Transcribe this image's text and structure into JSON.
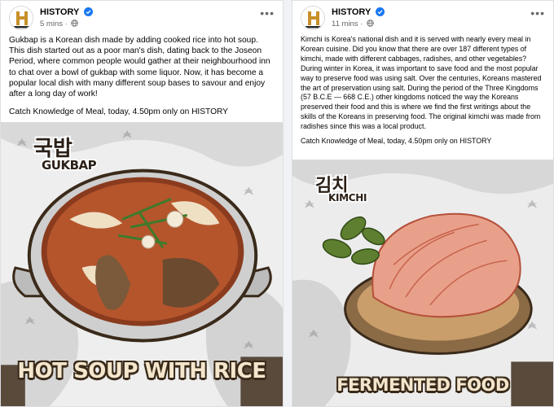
{
  "posts": [
    {
      "page_name": "HISTORY",
      "logo_text": "HISTORY",
      "time": "5 mins",
      "caption": "Gukbap is a Korean dish made by adding cooked rice into hot soup. This dish started out as a poor man's dish, dating back to the Joseon Period, where common people would gather at their neighbourhood inn to chat over a bowl of gukbap with some liquor. Now, it has become a popular local dish with many different soup bases to savour and enjoy after a long day of work!",
      "cta": "Catch Knowledge of Meal, today, 4.50pm only on HISTORY",
      "image": {
        "label_kr": "국밥",
        "label_en": "GUKBAP",
        "title": "HOT SOUP WITH RICE"
      }
    },
    {
      "page_name": "HISTORY",
      "logo_text": "HISTORY",
      "time": "11 mins",
      "caption": "Kimchi is Korea's national dish and it is served with nearly every meal in Korean cuisine. Did you know that there are over 187 different types of kimchi, made with different cabbages, radishes, and other vegetables?During winter in Korea, it was important to save food and the most popular way to preserve food was using salt. Over the centuries, Koreans mastered the art of preservation using salt. During the period of the Three Kingdoms (57 B.C.E — 668 C.E.) other kingdoms noticed the way the Koreans preserved their food and this is where we find the first writings about the skills of the Koreans in preserving food. The original kimchi was made from radishes since this was a local product.",
      "cta": "Catch Knowledge of Meal, today, 4.50pm only on HISTORY",
      "image": {
        "label_kr": "김치",
        "label_en": "KIMCHI",
        "title": "FERMENTED FOOD"
      }
    }
  ],
  "icons": {
    "verified": "verified-badge-icon",
    "globe": "globe-icon",
    "more": "more-options-icon"
  },
  "colors": {
    "verified_blue": "#1877f2",
    "secondary_text": "#65676b",
    "history_logo": "#c8902a"
  }
}
